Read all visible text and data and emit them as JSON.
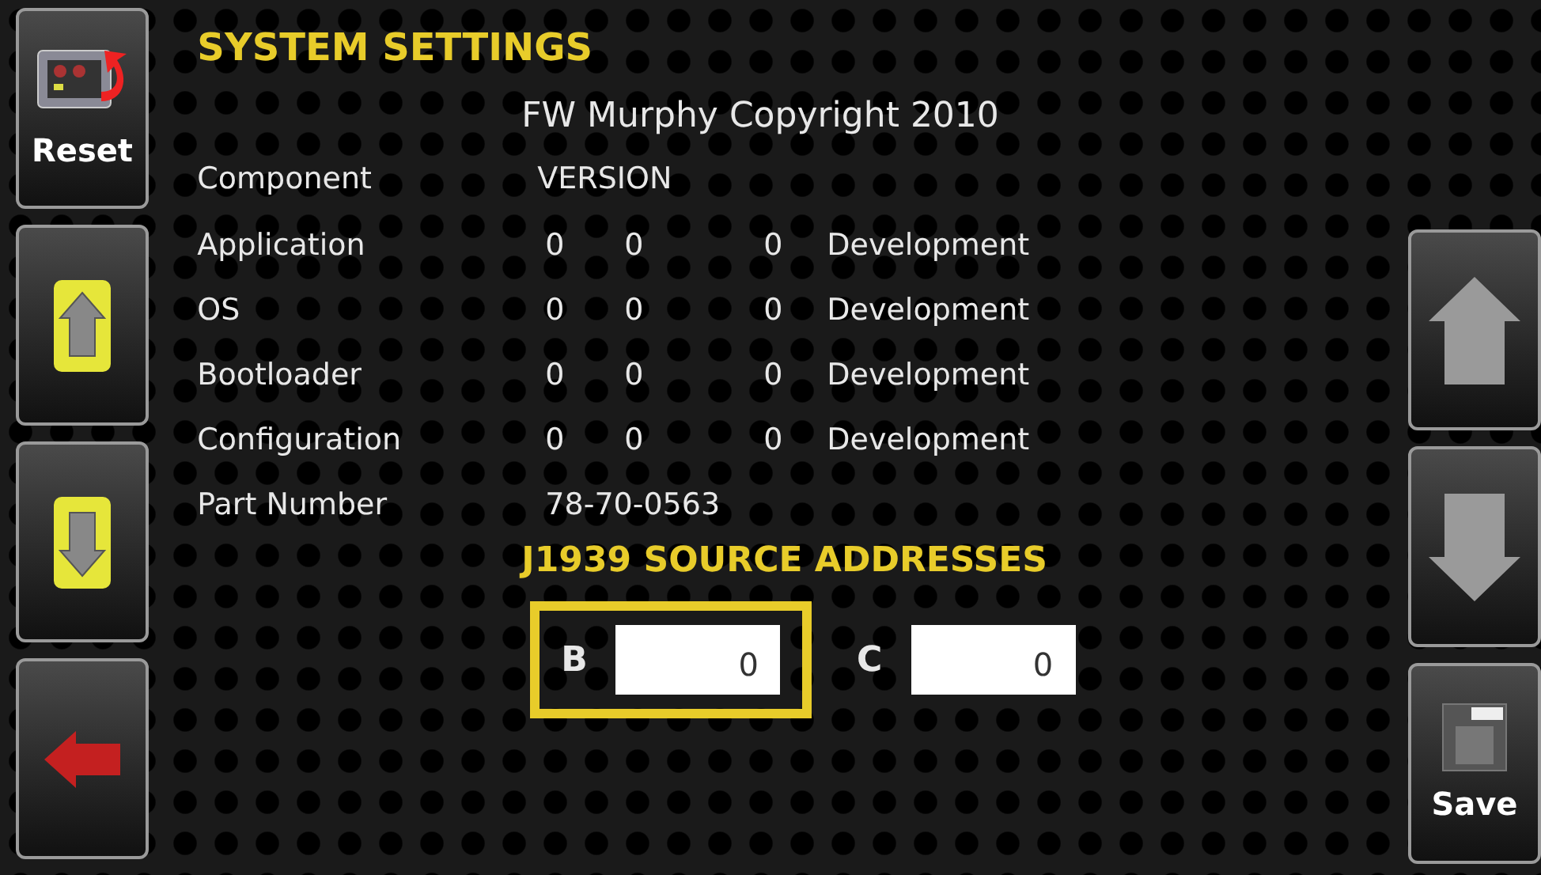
{
  "title": "SYSTEM SETTINGS",
  "copyright": "FW Murphy Copyright 2010",
  "header": {
    "component": "Component",
    "version": "VERSION"
  },
  "components": [
    {
      "name": "Application",
      "major": "0",
      "minor": "0",
      "build": "0",
      "status": "Development"
    },
    {
      "name": "OS",
      "major": "0",
      "minor": "0",
      "build": "0",
      "status": "Development"
    },
    {
      "name": "Bootloader",
      "major": "0",
      "minor": "0",
      "build": "0",
      "status": "Development"
    },
    {
      "name": "Configuration",
      "major": "0",
      "minor": "0",
      "build": "0",
      "status": "Development"
    }
  ],
  "part_number": {
    "label": "Part Number",
    "value": "78-70-0563"
  },
  "source_addresses": {
    "heading": "J1939 SOURCE ADDRESSES",
    "fields": [
      {
        "label": "B",
        "value": "0",
        "selected": true
      },
      {
        "label": "C",
        "value": "0",
        "selected": false
      }
    ]
  },
  "left_buttons": [
    {
      "kind": "reset",
      "label": "Reset"
    },
    {
      "kind": "up"
    },
    {
      "kind": "down"
    },
    {
      "kind": "back"
    }
  ],
  "right_buttons": [
    {
      "kind": "up"
    },
    {
      "kind": "down"
    },
    {
      "kind": "save",
      "label": "Save"
    }
  ]
}
